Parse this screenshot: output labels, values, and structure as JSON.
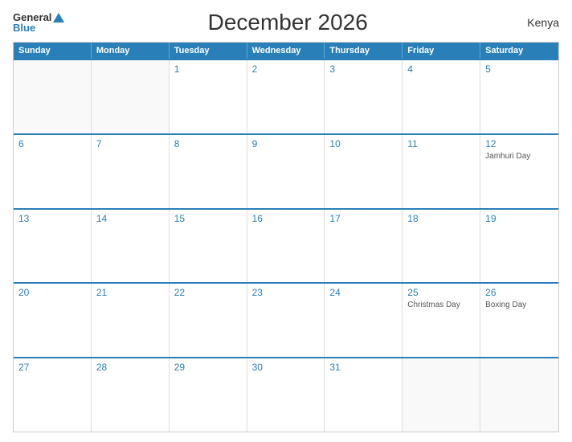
{
  "header": {
    "logo_general": "General",
    "logo_blue": "Blue",
    "title": "December 2026",
    "country": "Kenya"
  },
  "calendar": {
    "days_of_week": [
      "Sunday",
      "Monday",
      "Tuesday",
      "Wednesday",
      "Thursday",
      "Friday",
      "Saturday"
    ],
    "weeks": [
      [
        {
          "day": "",
          "event": ""
        },
        {
          "day": "",
          "event": ""
        },
        {
          "day": "1",
          "event": ""
        },
        {
          "day": "2",
          "event": ""
        },
        {
          "day": "3",
          "event": ""
        },
        {
          "day": "4",
          "event": ""
        },
        {
          "day": "5",
          "event": ""
        }
      ],
      [
        {
          "day": "6",
          "event": ""
        },
        {
          "day": "7",
          "event": ""
        },
        {
          "day": "8",
          "event": ""
        },
        {
          "day": "9",
          "event": ""
        },
        {
          "day": "10",
          "event": ""
        },
        {
          "day": "11",
          "event": ""
        },
        {
          "day": "12",
          "event": "Jamhuri Day"
        }
      ],
      [
        {
          "day": "13",
          "event": ""
        },
        {
          "day": "14",
          "event": ""
        },
        {
          "day": "15",
          "event": ""
        },
        {
          "day": "16",
          "event": ""
        },
        {
          "day": "17",
          "event": ""
        },
        {
          "day": "18",
          "event": ""
        },
        {
          "day": "19",
          "event": ""
        }
      ],
      [
        {
          "day": "20",
          "event": ""
        },
        {
          "day": "21",
          "event": ""
        },
        {
          "day": "22",
          "event": ""
        },
        {
          "day": "23",
          "event": ""
        },
        {
          "day": "24",
          "event": ""
        },
        {
          "day": "25",
          "event": "Christmas Day"
        },
        {
          "day": "26",
          "event": "Boxing Day"
        }
      ],
      [
        {
          "day": "27",
          "event": ""
        },
        {
          "day": "28",
          "event": ""
        },
        {
          "day": "29",
          "event": ""
        },
        {
          "day": "30",
          "event": ""
        },
        {
          "day": "31",
          "event": ""
        },
        {
          "day": "",
          "event": ""
        },
        {
          "day": "",
          "event": ""
        }
      ]
    ]
  }
}
